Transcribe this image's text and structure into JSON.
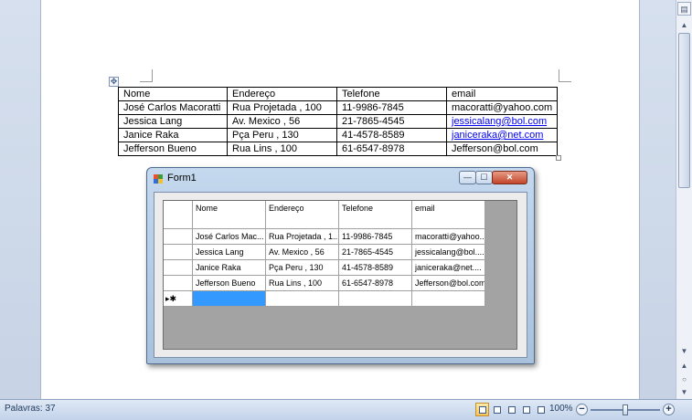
{
  "doc_table": {
    "headers": [
      "Nome",
      "Endereço",
      "Telefone",
      "email"
    ],
    "rows": [
      {
        "nome": "José Carlos Macoratti",
        "endereco": "Rua Projetada , 100",
        "telefone": "11-9986-7845",
        "email": "macoratti@yahoo.com",
        "email_link": false
      },
      {
        "nome": "Jessica Lang",
        "endereco": "Av. Mexico , 56",
        "telefone": "21-7865-4545",
        "email": "jessicalang@bol.com",
        "email_link": true
      },
      {
        "nome": "Janice Raka",
        "endereco": "Pça  Peru , 130",
        "telefone": "41-4578-8589",
        "email": "janiceraka@net.com",
        "email_link": true
      },
      {
        "nome": "Jefferson Bueno",
        "endereco": "Rua Lins , 100",
        "telefone": "61-6547-8978",
        "email": "Jefferson@bol.com",
        "email_link": false
      }
    ]
  },
  "form1": {
    "title": "Form1",
    "grid": {
      "headers": [
        "Nome",
        "Endereço",
        "Telefone",
        "email"
      ],
      "rows": [
        [
          "José Carlos Mac...",
          "Rua Projetada , 1...",
          "11-9986-7845",
          "macoratti@yahoo...."
        ],
        [
          "Jessica Lang",
          "Av. Mexico , 56",
          "21-7865-4545",
          "jessicalang@bol...."
        ],
        [
          "Janice Raka",
          "Pça  Peru , 130",
          "41-4578-8589",
          "janiceraka@net...."
        ],
        [
          "Jefferson Bueno",
          "Rua Lins , 100",
          "61-6547-8978",
          "Jefferson@bol.com"
        ]
      ],
      "new_row_marker": "▸✱"
    }
  },
  "statusbar": {
    "words": "Palavras: 37",
    "zoom": "100%",
    "zoom_minus": "−",
    "zoom_plus": "+",
    "zoom_level_percent": 100
  },
  "icons": {
    "table_move": "✥",
    "ruler_toggle": "▤",
    "scroll_up": "▲",
    "scroll_down": "▼",
    "browse_prev": "▲",
    "browse_object": "○",
    "browse_next": "▼",
    "minimize": "—",
    "maximize": "☐",
    "close": "✕"
  }
}
